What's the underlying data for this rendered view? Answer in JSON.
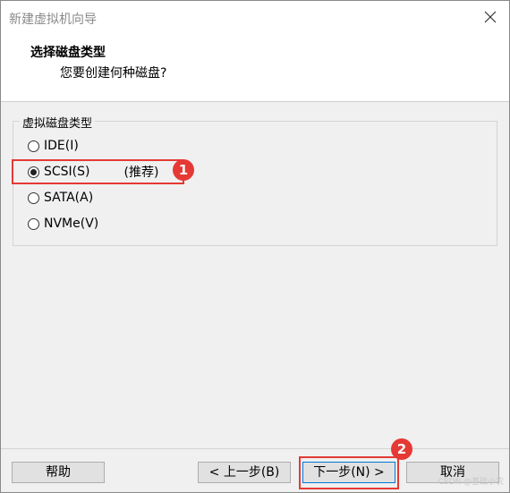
{
  "window": {
    "title": "新建虚拟机向导"
  },
  "header": {
    "title": "选择磁盘类型",
    "subtitle": "您要创建何种磁盘?"
  },
  "disk_group": {
    "legend": "虚拟磁盘类型",
    "options": [
      {
        "label": "IDE(I)",
        "checked": false
      },
      {
        "label": "SCSI(S)",
        "checked": true,
        "note": "(推荐)"
      },
      {
        "label": "SATA(A)",
        "checked": false
      },
      {
        "label": "NVMe(V)",
        "checked": false
      }
    ]
  },
  "buttons": {
    "help": "帮助",
    "back": "< 上一步(B)",
    "next": "下一步(N) >",
    "cancel": "取消"
  },
  "annotations": {
    "step1": "1",
    "step2": "2",
    "color": "#e53935"
  },
  "watermark": "CSDN @基础小农"
}
